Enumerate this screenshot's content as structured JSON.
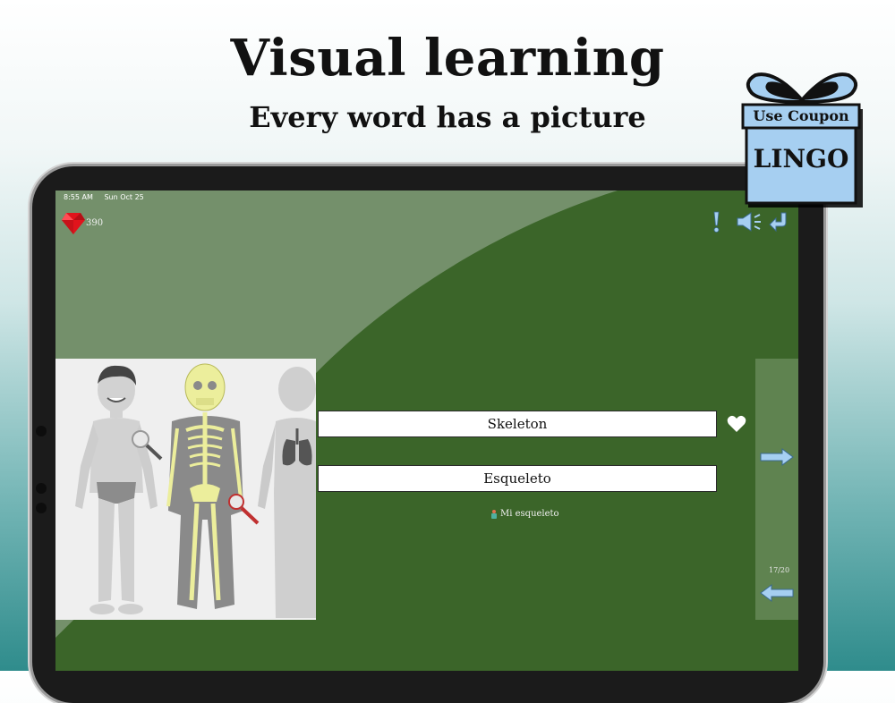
{
  "promo": {
    "headline": "Visual learning",
    "subline": "Every word has a picture"
  },
  "coupon": {
    "label": "Use Coupon",
    "code": "LINGO"
  },
  "status_bar": {
    "time": "8:55 AM",
    "date": "Sun Oct 25"
  },
  "score": {
    "points": "390",
    "icon": "ruby-gem-icon"
  },
  "toolbar": {
    "icons": [
      "exclamation-icon",
      "speaker-icon",
      "back-arrow-icon"
    ]
  },
  "card": {
    "image": "human-body-skeleton-lungs-illustration",
    "word": "Skeleton",
    "translation": "Esqueleto",
    "hint": "Mi esqueleto",
    "favorite_icon": "heart-icon"
  },
  "navigation": {
    "next_icon": "next-arrow-icon",
    "prev_icon": "previous-arrow-icon",
    "progress": "17/20"
  },
  "colors": {
    "screen_bg": "#3b6529",
    "light_wedge": "#74906b",
    "coupon_blue": "#a6cff1",
    "gem_red": "#e0141c"
  }
}
